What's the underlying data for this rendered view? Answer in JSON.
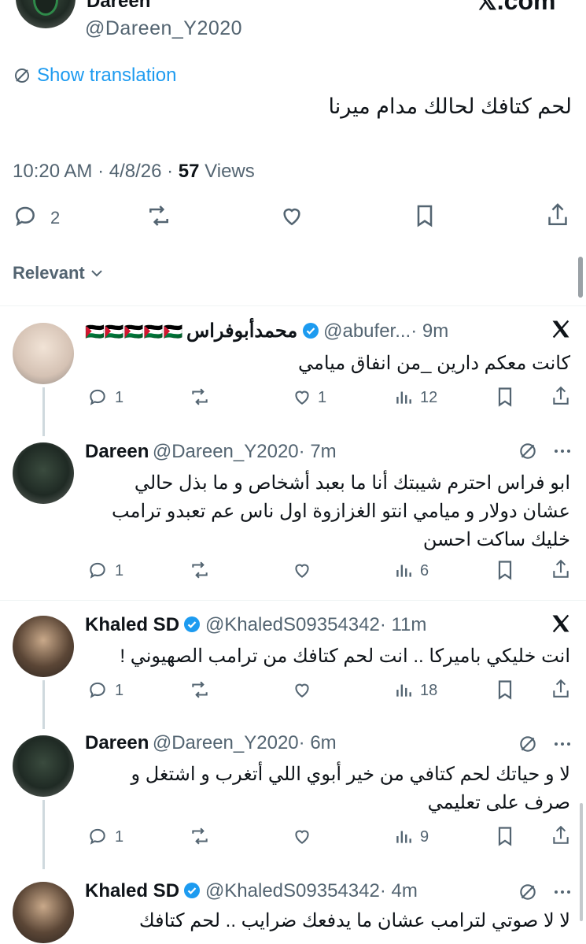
{
  "post": {
    "author_name": "Dareen",
    "author_handle": "@Dareen_Y2020",
    "watermark": "𝕏.com",
    "show_translation": "Show translation",
    "text": "لحم كتافك لحالك مدام ميرنا",
    "time": "10:20 AM · 4/8/26 · ",
    "views_count": "57",
    "views_label": " Views",
    "replies": "2"
  },
  "sort": {
    "label": "Relevant"
  },
  "replies": [
    {
      "name": "محمدأبوفراس",
      "flags": "🇵🇸🇵🇸🇵🇸🇵🇸🇵🇸",
      "handle": "@abufer...",
      "time": "· 9m",
      "text": "كانت معكم دارين _من انفاق ميامي",
      "replies": "1",
      "likes": "1",
      "views": "12"
    },
    {
      "name": "Dareen",
      "handle": "@Dareen_Y2020",
      "time": "· 7m",
      "text_lines": [
        "ابو فراس احترم شيبتك أنا ما بعبد أشخاص و ما بذل حالي",
        "عشان دولار و ميامي انتو الغزازوة اول ناس عم تعبدو ترامب",
        "خليك ساكت احسن"
      ],
      "replies": "1",
      "views": "6"
    },
    {
      "name": "Khaled SD",
      "handle": "@KhaledS09354342",
      "time": "· 11m",
      "text": "انت خليكي باميركا .. انت لحم كتافك من ترامب الصهيوني !",
      "replies": "1",
      "views": "18"
    },
    {
      "name": "Dareen",
      "handle": "@Dareen_Y2020",
      "time": "· 6m",
      "text_lines": [
        "لا و حياتك لحم كتافي من خير أبوي اللي أتغرب و اشتغل و",
        "صرف على تعليمي"
      ],
      "replies": "1",
      "views": "9"
    },
    {
      "name": "Khaled SD",
      "handle": "@KhaledS09354342",
      "time": "· 4m",
      "text": "لا لا صوتي لترامب عشان ما يدفعك ضرايب .. لحم كتافك"
    }
  ],
  "colors": {
    "link": "#1d9bf0",
    "verified": "#1d9bf0",
    "muted": "#536471"
  },
  "icons": [
    "reply-icon",
    "retweet-icon",
    "like-icon",
    "bookmark-icon",
    "share-icon",
    "views-icon",
    "x-logo-icon",
    "translate-icon",
    "more-icon",
    "verified-icon",
    "chevron-down-icon"
  ]
}
